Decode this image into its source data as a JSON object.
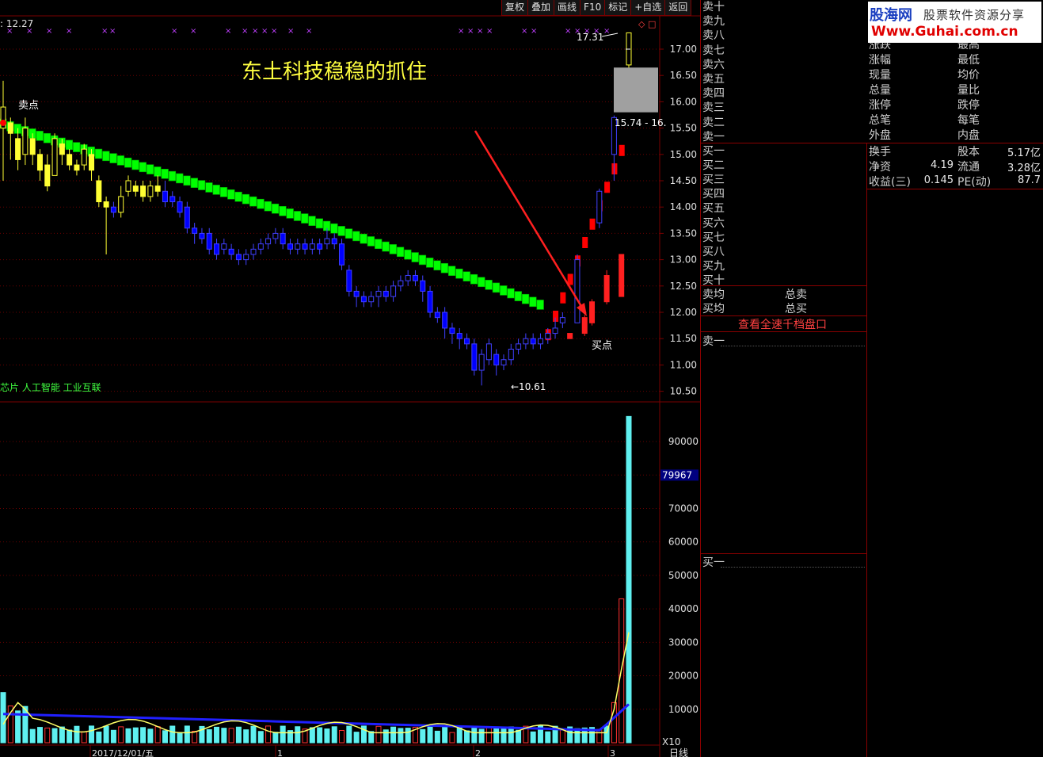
{
  "toolbar": [
    "复权",
    "叠加",
    "画线",
    "F10",
    "标记",
    "+自选",
    "返回"
  ],
  "logo": {
    "name": "股海网",
    "slogan": "股票软件资源分享",
    "url": "Www.Guhai.com.cn"
  },
  "price_chart": {
    "ma_label": ": 12.27",
    "annotation": "东土科技稳稳的抓住",
    "sell_label": "卖点",
    "buy_label": "买点",
    "low_label": "←10.61",
    "high_label": "17.31",
    "range_label": "15.74 - 16.",
    "concepts": "芯片 人工智能 工业互联",
    "corner_marks": "◇ □"
  },
  "volume_chart": {
    "current_label": "79967",
    "unit_label": "X10",
    "date_labels": [
      "2017/12/01/五",
      "1",
      "2",
      "3"
    ],
    "period_label": "日线"
  },
  "order_book": {
    "sell_levels": [
      "卖十",
      "卖九",
      "卖八",
      "卖七",
      "卖六",
      "卖五",
      "卖四",
      "卖三",
      "卖二",
      "卖一"
    ],
    "buy_levels": [
      "买一",
      "买二",
      "买三",
      "买四",
      "买五",
      "买六",
      "买七",
      "买八",
      "买九",
      "买十"
    ],
    "avg_sell": "卖均",
    "avg_buy": "买均",
    "total_sell": "总卖",
    "total_buy": "总买",
    "depth_link": "查看全速千档盘口",
    "sell_one_box": "卖一",
    "buy_one_box": "买一"
  },
  "quote": {
    "rows_left": [
      "涨跌",
      "涨幅",
      "现量",
      "总量",
      "涨停",
      "总笔",
      "外盘"
    ],
    "rows_right": [
      "最高",
      "最低",
      "均价",
      "量比",
      "跌停",
      "每笔",
      "内盘"
    ],
    "turnover_label": "换手",
    "share_label": "股本",
    "share_value": "5.17亿",
    "net_asset_label": "净资",
    "net_asset_value": "4.19",
    "float_label": "流通",
    "float_value": "3.28亿",
    "eps_label": "收益(三)",
    "eps_value": "0.145",
    "pe_label": "PE(动)",
    "pe_value": "87.7"
  },
  "colors": {
    "up": "#ff2020",
    "down_dark": "#0000ff",
    "yellow_candle": "#ffff33",
    "ribbon": "#00ff00",
    "volume_bar": "#5ff0f0",
    "ma_volume": "#2020ff",
    "grid": "#7a0000",
    "axis_text": "#e0e0e0"
  },
  "chart_data": [
    {
      "type": "candlestick",
      "y_ticks": [
        17.0,
        16.5,
        16.0,
        15.5,
        15.0,
        14.5,
        14.0,
        13.5,
        13.0,
        12.5,
        12.0,
        11.5,
        11.0,
        10.5
      ],
      "ylim": [
        10.3,
        17.6
      ],
      "candles": [
        {
          "c": "y",
          "o": 15.5,
          "c2": 15.9,
          "h": 16.4,
          "l": 14.5
        },
        {
          "c": "y",
          "o": 15.6,
          "c2": 15.4,
          "h": 15.7,
          "l": 14.9
        },
        {
          "c": "y",
          "o": 15.3,
          "c2": 14.9,
          "h": 15.5,
          "l": 14.7
        },
        {
          "c": "y",
          "o": 15.0,
          "c2": 15.5,
          "h": 15.7,
          "l": 14.8
        },
        {
          "c": "y",
          "o": 15.3,
          "c2": 15.0,
          "h": 15.4,
          "l": 14.8
        },
        {
          "c": "y",
          "o": 15.0,
          "c2": 14.7,
          "h": 15.1,
          "l": 14.5
        },
        {
          "c": "y",
          "o": 14.8,
          "c2": 14.4,
          "h": 15.0,
          "l": 14.3
        },
        {
          "c": "y",
          "o": 14.6,
          "c2": 15.3,
          "h": 15.4,
          "l": 14.6
        },
        {
          "c": "y",
          "o": 15.2,
          "c2": 15.0,
          "h": 15.3,
          "l": 14.8
        },
        {
          "c": "y",
          "o": 15.0,
          "c2": 14.8,
          "h": 15.1,
          "l": 14.7
        },
        {
          "c": "y",
          "o": 14.8,
          "c2": 14.7,
          "h": 14.9,
          "l": 14.6
        },
        {
          "c": "y",
          "o": 14.8,
          "c2": 15.1,
          "h": 15.2,
          "l": 14.7
        },
        {
          "c": "y",
          "o": 15.0,
          "c2": 14.7,
          "h": 15.1,
          "l": 14.5
        },
        {
          "c": "y",
          "o": 14.5,
          "c2": 14.1,
          "h": 14.6,
          "l": 14.0
        },
        {
          "c": "y",
          "o": 14.1,
          "c2": 14.0,
          "h": 14.2,
          "l": 13.1
        },
        {
          "c": "b",
          "o": 14.0,
          "c2": 13.9,
          "h": 14.1,
          "l": 13.8
        },
        {
          "c": "y",
          "o": 13.9,
          "c2": 14.2,
          "h": 14.4,
          "l": 13.8
        },
        {
          "c": "y",
          "o": 14.3,
          "c2": 14.5,
          "h": 14.6,
          "l": 14.2
        },
        {
          "c": "y",
          "o": 14.4,
          "c2": 14.3,
          "h": 14.5,
          "l": 14.2
        },
        {
          "c": "y",
          "o": 14.4,
          "c2": 14.2,
          "h": 14.5,
          "l": 14.1
        },
        {
          "c": "y",
          "o": 14.2,
          "c2": 14.4,
          "h": 14.5,
          "l": 14.1
        },
        {
          "c": "y",
          "o": 14.4,
          "c2": 14.3,
          "h": 14.6,
          "l": 14.2
        },
        {
          "c": "b",
          "o": 14.3,
          "c2": 14.1,
          "h": 14.5,
          "l": 14.0
        },
        {
          "c": "b",
          "o": 14.2,
          "c2": 14.1,
          "h": 14.3,
          "l": 14.0
        },
        {
          "c": "b",
          "o": 14.1,
          "c2": 13.9,
          "h": 14.2,
          "l": 13.8
        },
        {
          "c": "b",
          "o": 14.0,
          "c2": 13.6,
          "h": 14.1,
          "l": 13.5
        },
        {
          "c": "b",
          "o": 13.6,
          "c2": 13.5,
          "h": 13.7,
          "l": 13.3
        },
        {
          "c": "b",
          "o": 13.5,
          "c2": 13.4,
          "h": 13.6,
          "l": 13.3
        },
        {
          "c": "b",
          "o": 13.5,
          "c2": 13.2,
          "h": 13.6,
          "l": 13.1
        },
        {
          "c": "b",
          "o": 13.3,
          "c2": 13.1,
          "h": 13.4,
          "l": 13.0
        },
        {
          "c": "b",
          "o": 13.2,
          "c2": 13.3,
          "h": 13.4,
          "l": 13.1
        },
        {
          "c": "b",
          "o": 13.2,
          "c2": 13.1,
          "h": 13.3,
          "l": 13.0
        },
        {
          "c": "b",
          "o": 13.1,
          "c2": 13.0,
          "h": 13.2,
          "l": 12.9
        },
        {
          "c": "b",
          "o": 13.0,
          "c2": 13.1,
          "h": 13.2,
          "l": 12.9
        },
        {
          "c": "b",
          "o": 13.1,
          "c2": 13.2,
          "h": 13.3,
          "l": 13.0
        },
        {
          "c": "b",
          "o": 13.2,
          "c2": 13.3,
          "h": 13.4,
          "l": 13.1
        },
        {
          "c": "b",
          "o": 13.3,
          "c2": 13.4,
          "h": 13.5,
          "l": 13.2
        },
        {
          "c": "b",
          "o": 13.4,
          "c2": 13.5,
          "h": 13.6,
          "l": 13.3
        },
        {
          "c": "b",
          "o": 13.5,
          "c2": 13.3,
          "h": 13.6,
          "l": 13.2
        },
        {
          "c": "b",
          "o": 13.3,
          "c2": 13.2,
          "h": 13.4,
          "l": 13.1
        },
        {
          "c": "b",
          "o": 13.2,
          "c2": 13.3,
          "h": 13.4,
          "l": 13.1
        },
        {
          "c": "b",
          "o": 13.3,
          "c2": 13.2,
          "h": 13.4,
          "l": 13.1
        },
        {
          "c": "b",
          "o": 13.2,
          "c2": 13.3,
          "h": 13.4,
          "l": 13.1
        },
        {
          "c": "b",
          "o": 13.3,
          "c2": 13.2,
          "h": 13.4,
          "l": 13.1
        },
        {
          "c": "b",
          "o": 13.3,
          "c2": 13.4,
          "h": 13.6,
          "l": 13.2
        },
        {
          "c": "b",
          "o": 13.4,
          "c2": 13.3,
          "h": 13.5,
          "l": 13.2
        },
        {
          "c": "b",
          "o": 13.3,
          "c2": 12.9,
          "h": 13.4,
          "l": 12.8
        },
        {
          "c": "b",
          "o": 12.8,
          "c2": 12.4,
          "h": 12.9,
          "l": 12.3
        },
        {
          "c": "b",
          "o": 12.4,
          "c2": 12.3,
          "h": 12.5,
          "l": 12.1
        },
        {
          "c": "b",
          "o": 12.3,
          "c2": 12.2,
          "h": 12.4,
          "l": 12.1
        },
        {
          "c": "b",
          "o": 12.2,
          "c2": 12.3,
          "h": 12.4,
          "l": 12.1
        },
        {
          "c": "b",
          "o": 12.3,
          "c2": 12.4,
          "h": 12.5,
          "l": 12.1
        },
        {
          "c": "b",
          "o": 12.4,
          "c2": 12.3,
          "h": 12.5,
          "l": 12.2
        },
        {
          "c": "b",
          "o": 12.3,
          "c2": 12.5,
          "h": 12.6,
          "l": 12.2
        },
        {
          "c": "b",
          "o": 12.5,
          "c2": 12.6,
          "h": 12.7,
          "l": 12.4
        },
        {
          "c": "b",
          "o": 12.6,
          "c2": 12.7,
          "h": 12.8,
          "l": 12.5
        },
        {
          "c": "b",
          "o": 12.7,
          "c2": 12.6,
          "h": 12.8,
          "l": 12.5
        },
        {
          "c": "b",
          "o": 12.6,
          "c2": 12.4,
          "h": 12.7,
          "l": 12.2
        },
        {
          "c": "b",
          "o": 12.4,
          "c2": 12.0,
          "h": 12.5,
          "l": 11.9
        },
        {
          "c": "b",
          "o": 12.0,
          "c2": 11.9,
          "h": 12.1,
          "l": 11.8
        },
        {
          "c": "b",
          "o": 12.0,
          "c2": 11.7,
          "h": 12.1,
          "l": 11.5
        },
        {
          "c": "b",
          "o": 11.7,
          "c2": 11.6,
          "h": 11.8,
          "l": 11.4
        },
        {
          "c": "b",
          "o": 11.6,
          "c2": 11.5,
          "h": 11.7,
          "l": 11.3
        },
        {
          "c": "b",
          "o": 11.5,
          "c2": 11.4,
          "h": 11.6,
          "l": 11.3
        },
        {
          "c": "b",
          "o": 11.4,
          "c2": 10.9,
          "h": 11.5,
          "l": 10.8
        },
        {
          "c": "b",
          "o": 10.9,
          "c2": 11.2,
          "h": 11.3,
          "l": 10.61
        },
        {
          "c": "b",
          "o": 11.1,
          "c2": 11.4,
          "h": 11.5,
          "l": 11.0
        },
        {
          "c": "b",
          "o": 11.2,
          "c2": 11.0,
          "h": 11.3,
          "l": 10.8
        },
        {
          "c": "b",
          "o": 11.0,
          "c2": 11.1,
          "h": 11.2,
          "l": 10.9
        },
        {
          "c": "b",
          "o": 11.1,
          "c2": 11.3,
          "h": 11.4,
          "l": 11.0
        },
        {
          "c": "b",
          "o": 11.3,
          "c2": 11.4,
          "h": 11.5,
          "l": 11.2
        },
        {
          "c": "b",
          "o": 11.4,
          "c2": 11.5,
          "h": 11.6,
          "l": 11.3
        },
        {
          "c": "b",
          "o": 11.5,
          "c2": 11.4,
          "h": 11.6,
          "l": 11.3
        },
        {
          "c": "b",
          "o": 11.4,
          "c2": 11.5,
          "h": 11.6,
          "l": 11.3
        },
        {
          "c": "b",
          "o": 11.5,
          "c2": 11.6,
          "h": 11.7,
          "l": 11.4
        },
        {
          "c": "b",
          "o": 11.6,
          "c2": 11.7,
          "h": 11.9,
          "l": 11.5
        },
        {
          "c": "b",
          "o": 11.8,
          "c2": 11.9,
          "h": 12.0,
          "l": 11.7
        },
        {
          "c": "r",
          "o": 11.5,
          "c2": 11.6,
          "h": 11.6,
          "l": 11.5
        },
        {
          "c": "b",
          "o": 11.8,
          "c2": 13.0,
          "h": 13.1,
          "l": 11.8
        },
        {
          "c": "r",
          "o": 11.6,
          "c2": 11.9,
          "h": 11.95,
          "l": 11.55
        },
        {
          "c": "r",
          "o": 11.8,
          "c2": 12.2,
          "h": 12.25,
          "l": 11.75
        },
        {
          "c": "b",
          "o": 13.7,
          "c2": 14.3,
          "h": 14.35,
          "l": 13.6
        },
        {
          "c": "r",
          "o": 12.2,
          "c2": 12.7,
          "h": 12.8,
          "l": 12.15
        },
        {
          "c": "b",
          "o": 15.0,
          "c2": 15.7,
          "h": 15.74,
          "l": 14.5
        },
        {
          "c": "r",
          "o": 12.3,
          "c2": 13.1,
          "h": 13.1,
          "l": 12.3
        },
        {
          "c": "y",
          "o": 16.7,
          "c2": 17.31,
          "h": 17.31,
          "l": 16.6
        }
      ],
      "gap_box": [
        15.8,
        16.65
      ]
    },
    {
      "type": "bar",
      "y_ticks": [
        90000,
        80000,
        70000,
        60000,
        50000,
        40000,
        30000,
        20000,
        10000
      ],
      "ylim": [
        0,
        100000
      ],
      "last_volume": 79967
    }
  ]
}
